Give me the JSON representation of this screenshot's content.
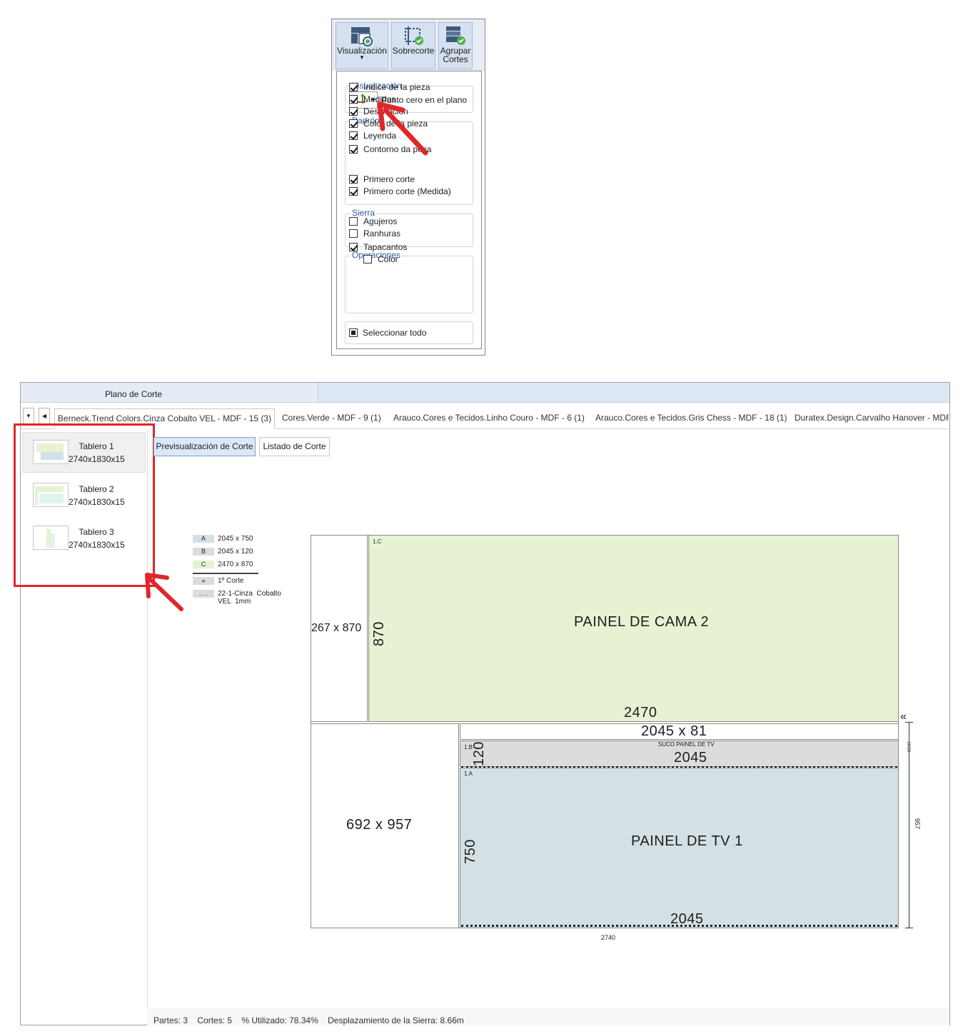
{
  "ribbon": {
    "buttons": [
      {
        "label": "Visualización",
        "icon": "display-layout-icon"
      },
      {
        "label": "Sobrecorte",
        "icon": "overcut-check-icon"
      },
      {
        "label": "Agrupar\nCortes",
        "icon": "group-cuts-icon"
      }
    ],
    "menu": {
      "visualizacion": {
        "title": "Visualización",
        "value": "Punto cero en el plano"
      },
      "padron": {
        "title": "Padrón",
        "items": [
          {
            "label": "Índice de la pieza",
            "checked": true
          },
          {
            "label": "Medidas",
            "checked": true
          },
          {
            "label": "Descripción",
            "checked": true
          },
          {
            "label": "Color de la pieza",
            "checked": true
          },
          {
            "label": "Leyenda",
            "checked": true
          },
          {
            "label": "Contorno da peça",
            "checked": true
          }
        ]
      },
      "sierra": {
        "title": "Sierra",
        "items": [
          {
            "label": "Primero corte",
            "checked": true
          },
          {
            "label": "Primero corte (Medida)",
            "checked": true
          }
        ]
      },
      "operaciones": {
        "title": "Operaciones",
        "items": [
          {
            "label": "Agujeros",
            "checked": false
          },
          {
            "label": "Ranhuras",
            "checked": false
          },
          {
            "label": "Tapacantos",
            "checked": true
          },
          {
            "label": "Color",
            "checked": false
          }
        ]
      },
      "select_all": "Seleccionar todo"
    }
  },
  "window": {
    "title": "Plano de Corte",
    "material_tabs": [
      "Berneck.Trend Colors.Cinza Cobalto VEL - MDF - 15 (3)",
      "Cores.Verde - MDF - 9 (1)",
      "Arauco.Cores e Tecidos.Linho Couro - MDF - 6 (1)",
      "Arauco.Cores e Tecidos.Gris Chess - MDF - 18 (1)",
      "Duratex.Design.Carvalho Hanover - MDF -"
    ],
    "sheets": [
      {
        "name": "Tablero 1",
        "size": "2740x1830x15"
      },
      {
        "name": "Tablero 2",
        "size": "2740x1830x15"
      },
      {
        "name": "Tablero 3",
        "size": "2740x1830x15"
      }
    ],
    "view_buttons": {
      "preview": "Previsualización de Corte",
      "list": "Listado de Corte"
    },
    "legend": [
      {
        "key": "A",
        "text": "2045 x 750",
        "color": "#d3e0e8"
      },
      {
        "key": "B",
        "text": "2045 x 120",
        "color": "#dcdcdc"
      },
      {
        "key": "C",
        "text": "2470 x 870",
        "color": "#e6f2d2"
      },
      {
        "key": "»",
        "text": "1º Corte",
        "color": "#dcdcdc"
      },
      {
        "key": ". . .",
        "text": "22-1-Cinza  Cobalto\nVEL  1mm",
        "color": "#dcdcdc"
      }
    ],
    "plan": {
      "scrap_top": "267 x 870",
      "piece_c": {
        "index": "1.C",
        "name": "PAINEL DE CAMA 2",
        "height": "870",
        "width": "2470"
      },
      "strip_top": "2045 x 81",
      "piece_b": {
        "index": "1.B",
        "name": "SUCO PAINEL DE TV",
        "height": "120",
        "width": "2045"
      },
      "piece_a": {
        "index": "1.A",
        "name": "PAINEL DE TV 1",
        "height": "750",
        "width": "2045"
      },
      "scrap_left": "692 x 957",
      "dim_bottom": "2740",
      "dim_right_small": "1830",
      "dim_right": "957",
      "first_cut_mark": "«"
    },
    "status": "Partes: 3    Cortes: 5    % Utilizado: 78.34%    Desplazamiento de la Sierra: 8.66m"
  },
  "annotations": {
    "highlight_color": "#e0262b",
    "arrow_color": "#e0262b"
  }
}
